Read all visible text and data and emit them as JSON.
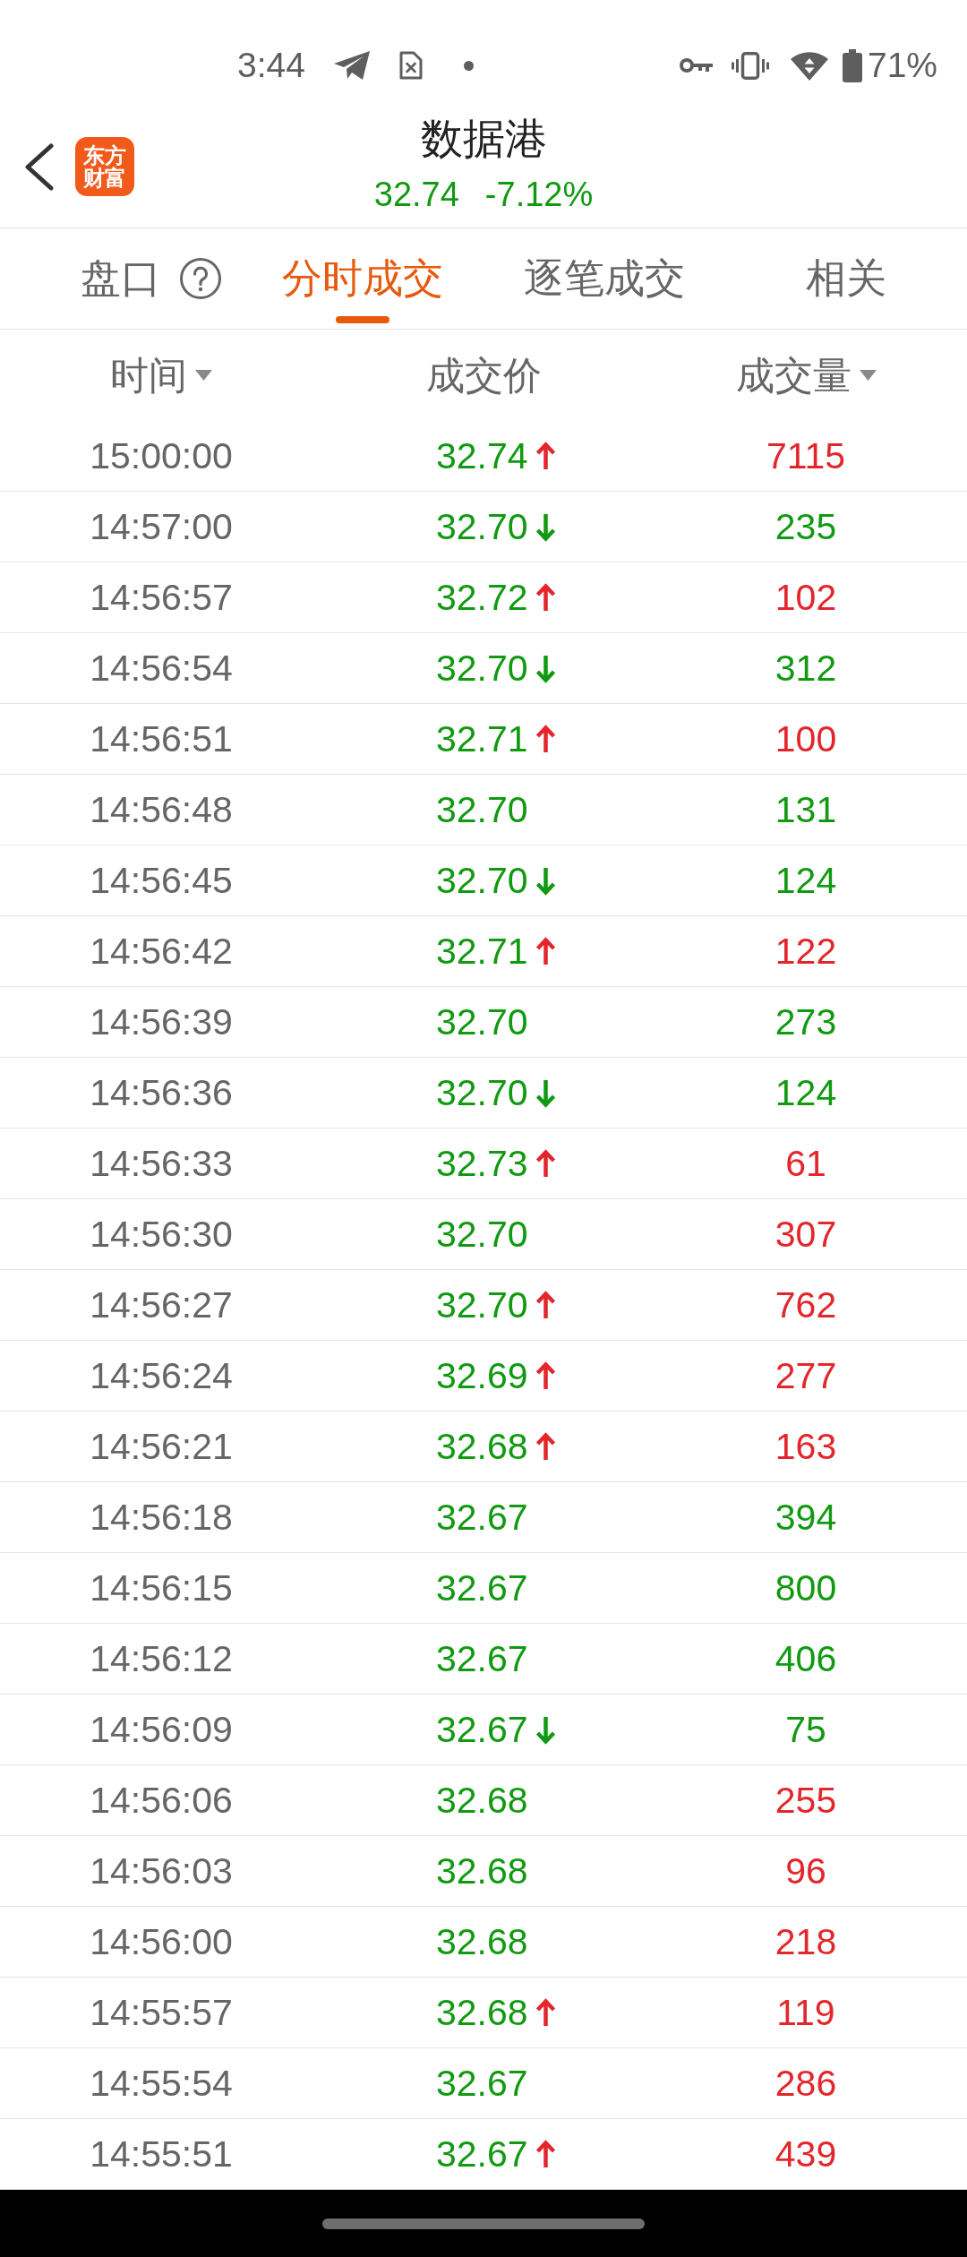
{
  "status_bar": {
    "time": "3:44",
    "battery": "71%"
  },
  "header": {
    "logo": "东方财富",
    "title": "数据港",
    "price": "32.74",
    "change": "-7.12%"
  },
  "tabs": [
    {
      "label": "盘口",
      "help": true,
      "selected": false
    },
    {
      "label": "分时成交",
      "help": false,
      "selected": true
    },
    {
      "label": "逐笔成交",
      "help": false,
      "selected": false
    },
    {
      "label": "相关",
      "help": false,
      "selected": false
    }
  ],
  "table": {
    "columns": [
      {
        "label": "时间",
        "sortable": true
      },
      {
        "label": "成交价",
        "sortable": false
      },
      {
        "label": "成交量",
        "sortable": true
      }
    ],
    "rows": [
      {
        "time": "15:00:00",
        "price": "32.74",
        "kind": "up",
        "volume": "7115",
        "color": "#e3262c"
      },
      {
        "time": "14:57:00",
        "price": "32.70",
        "kind": "down",
        "volume": "235",
        "color": "#119a11"
      },
      {
        "time": "14:56:57",
        "price": "32.72",
        "kind": "up",
        "volume": "102",
        "color": "#e3262c"
      },
      {
        "time": "14:56:54",
        "price": "32.70",
        "kind": "down",
        "volume": "312",
        "color": "#119a11"
      },
      {
        "time": "14:56:51",
        "price": "32.71",
        "kind": "up",
        "volume": "100",
        "color": "#e3262c"
      },
      {
        "time": "14:56:48",
        "price": "32.70",
        "kind": "plain",
        "volume": "131",
        "color": "#119a11"
      },
      {
        "time": "14:56:45",
        "price": "32.70",
        "kind": "down",
        "volume": "124",
        "color": "#119a11"
      },
      {
        "time": "14:56:42",
        "price": "32.71",
        "kind": "up",
        "volume": "122",
        "color": "#e3262c"
      },
      {
        "time": "14:56:39",
        "price": "32.70",
        "kind": "plain",
        "volume": "273",
        "color": "#119a11"
      },
      {
        "time": "14:56:36",
        "price": "32.70",
        "kind": "down",
        "volume": "124",
        "color": "#119a11"
      },
      {
        "time": "14:56:33",
        "price": "32.73",
        "kind": "up",
        "volume": "61",
        "color": "#e3262c"
      },
      {
        "time": "14:56:30",
        "price": "32.70",
        "kind": "plain",
        "volume": "307",
        "color": "#e3262c"
      },
      {
        "time": "14:56:27",
        "price": "32.70",
        "kind": "up",
        "volume": "762",
        "color": "#e3262c"
      },
      {
        "time": "14:56:24",
        "price": "32.69",
        "kind": "up",
        "volume": "277",
        "color": "#e3262c"
      },
      {
        "time": "14:56:21",
        "price": "32.68",
        "kind": "up",
        "volume": "163",
        "color": "#e3262c"
      },
      {
        "time": "14:56:18",
        "price": "32.67",
        "kind": "plain",
        "volume": "394",
        "color": "#119a11"
      },
      {
        "time": "14:56:15",
        "price": "32.67",
        "kind": "plain",
        "volume": "800",
        "color": "#119a11"
      },
      {
        "time": "14:56:12",
        "price": "32.67",
        "kind": "plain",
        "volume": "406",
        "color": "#119a11"
      },
      {
        "time": "14:56:09",
        "price": "32.67",
        "kind": "down",
        "volume": "75",
        "color": "#119a11"
      },
      {
        "time": "14:56:06",
        "price": "32.68",
        "kind": "plain",
        "volume": "255",
        "color": "#e3262c"
      },
      {
        "time": "14:56:03",
        "price": "32.68",
        "kind": "plain",
        "volume": "96",
        "color": "#e3262c"
      },
      {
        "time": "14:56:00",
        "price": "32.68",
        "kind": "plain",
        "volume": "218",
        "color": "#e3262c"
      },
      {
        "time": "14:55:57",
        "price": "32.68",
        "kind": "up",
        "volume": "119",
        "color": "#e3262c"
      },
      {
        "time": "14:55:54",
        "price": "32.67",
        "kind": "plain",
        "volume": "286",
        "color": "#e3262c"
      },
      {
        "time": "14:55:51",
        "price": "32.67",
        "kind": "up",
        "volume": "439",
        "color": "#e3262c"
      }
    ]
  }
}
